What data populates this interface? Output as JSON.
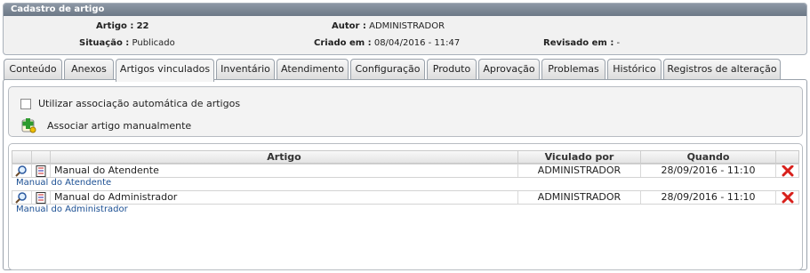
{
  "panel": {
    "title": "Cadastro de artigo",
    "artigo_label": "Artigo :",
    "artigo_value": "22",
    "autor_label": "Autor :",
    "autor_value": "ADMINISTRADOR",
    "situacao_label": "Situação :",
    "situacao_value": "Publicado",
    "criado_label": "Criado em :",
    "criado_value": "08/04/2016 - 11:47",
    "revisado_label": "Revisado em :",
    "revisado_value": "-"
  },
  "tabs": [
    "Conteúdo",
    "Anexos",
    "Artigos vinculados",
    "Inventário",
    "Atendimento",
    "Configuração",
    "Produto",
    "Aprovação",
    "Problemas",
    "Histórico",
    "Registros de alteração"
  ],
  "options": {
    "auto_assoc_label": "Utilizar associação automática de artigos",
    "auto_assoc_checked": false,
    "manual_assoc_label": "Associar artigo manualmente"
  },
  "table": {
    "headers": {
      "artigo": "Artigo",
      "vinculado": "Viculado por",
      "quando": "Quando"
    },
    "rows": [
      {
        "title": "Manual do Atendente",
        "by": "ADMINISTRADOR",
        "when": "28/09/2016 - 11:10",
        "link": "Manual do Atendente"
      },
      {
        "title": "Manual do Administrador",
        "by": "ADMINISTRADOR",
        "when": "28/09/2016 - 11:10",
        "link": "Manual do Administrador"
      }
    ]
  },
  "colors": {
    "header_bar": "#7a8593",
    "link": "#1b4f93",
    "delete": "#d8201b"
  },
  "icons": {
    "view": "magnifier-icon",
    "details": "document-list-icon",
    "delete": "delete-x-icon",
    "add": "add-article-icon"
  }
}
